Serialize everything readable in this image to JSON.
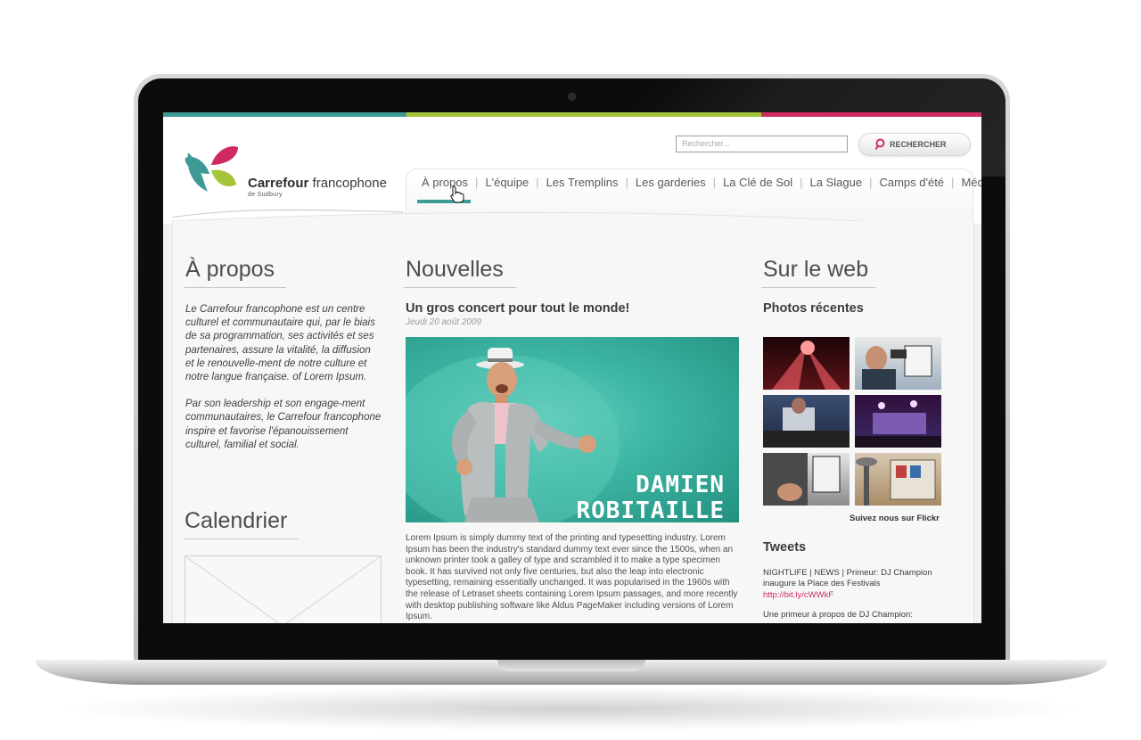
{
  "colors": {
    "teal": "#3f9a96",
    "green": "#a4c439",
    "pink": "#d02a63",
    "gray": "#5a5a5a"
  },
  "search": {
    "placeholder": "Rechercher...",
    "button_label": "RECHERCHER"
  },
  "logo": {
    "brand_bold": "Carrefour",
    "brand_rest": " francophone",
    "subtitle": "de Sudbury",
    "icon": "leaf-petals-logo"
  },
  "nav": {
    "items": [
      "À propos",
      "L'équipe",
      "Les Tremplins",
      "Les garderies",
      "La Clé de Sol",
      "La Slague",
      "Camps d'été",
      "Média"
    ],
    "separator": "|",
    "active": "À propos"
  },
  "about": {
    "title": "À propos",
    "p1": "Le Carrefour francophone est un centre culturel et communautaire qui, par le biais de sa programmation, ses activités et ses partenaires, assure la vitalité, la diffusion et le renouvelle-ment de notre culture et notre langue française. of Lorem Ipsum.",
    "p2": "Par son leadership et son engage-ment communautaires, le Carrefour francophone inspire et favorise l'épanouissement culturel, familial et social."
  },
  "calendar": {
    "title": "Calendrier"
  },
  "news": {
    "title": "Nouvelles",
    "headline": "Un gros concert pour tout le monde!",
    "date": "Jeudi 20 août 2009",
    "image_text_line1": "DAMIEN",
    "image_text_line2": "ROBITAILLE",
    "body": "Lorem Ipsum is simply dummy text of the printing and typesetting industry. Lorem Ipsum has been the industry's standard dummy text ever since the 1500s, when an unknown printer took a galley of type and scrambled it to make a type specimen book. It has survived not only five centuries, but also the leap into electronic typesetting, remaining essentially unchanged. It was popularised in the 1960s with the release of Letraset sheets containing Lorem Ipsum passages, and more recently with desktop publishing software like Aldus PageMaker including versions of Lorem Ipsum."
  },
  "web": {
    "title": "Sur le web",
    "photos_title": "Photos récentes",
    "flickr_link": "Suivez nous sur Flickr",
    "tweets_title": "Tweets",
    "tweet1_text": "NIGHTLIFE | NEWS | Primeur: DJ Champion inaugure la Place des Festivals",
    "tweet1_link": "http://bit.ly/cWWkF",
    "tweet2_text": "Une primeur à propos de DJ Champion:"
  }
}
